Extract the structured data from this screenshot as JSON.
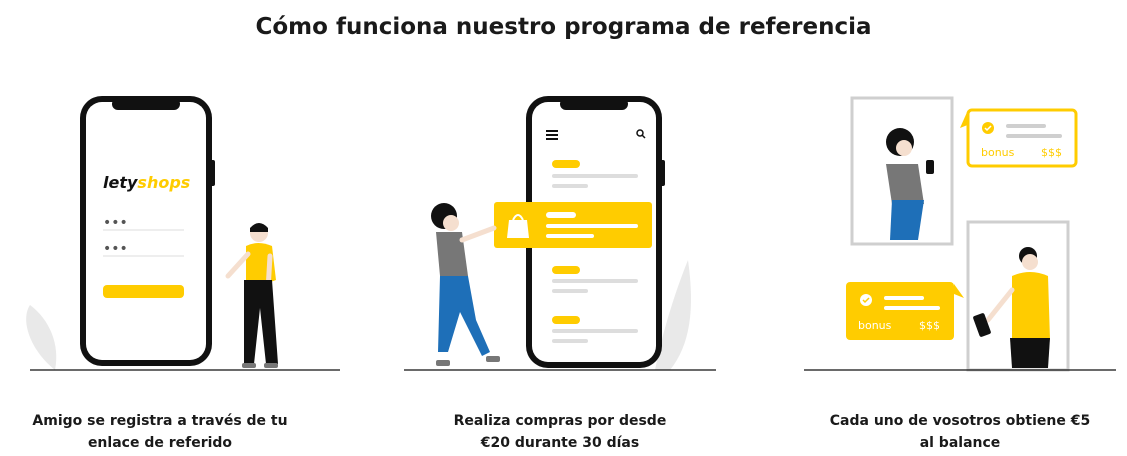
{
  "title": "Cómo funciona nuestro programa de referencia",
  "colors": {
    "accent": "#FFCC00",
    "dark": "#111111",
    "gray": "#CFCFCF",
    "light_gray": "#E6E6E6",
    "blue": "#1E6FB8"
  },
  "steps": [
    {
      "line1": "Amigo se registra a través de tu",
      "line2": "enlace de referido",
      "logo_lety": "lety",
      "logo_shops": "shops",
      "password_mask_1": "•••",
      "password_mask_2": "•••"
    },
    {
      "line1": "Realiza compras por desde",
      "line2": "€20 durante 30 días"
    },
    {
      "line1": "Cada uno de vosotros obtiene €5",
      "line2": "al balance",
      "bonus_label_top": "bonus",
      "bonus_amount_top": "$$$",
      "bonus_label_bottom": "bonus",
      "bonus_amount_bottom": "$$$"
    }
  ]
}
